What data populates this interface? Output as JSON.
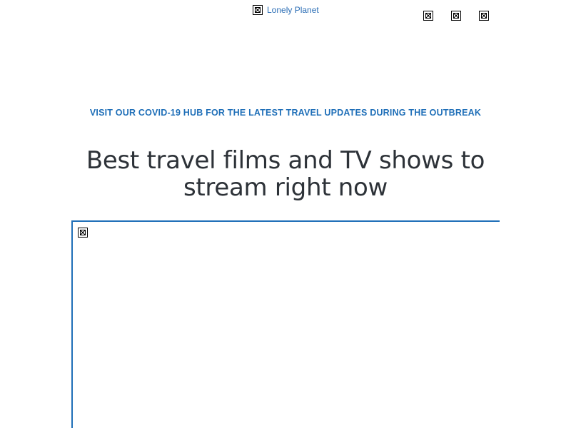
{
  "header": {
    "logo_label": "Lonely Planet",
    "icons": [
      "broken-image-icon",
      "broken-image-icon",
      "broken-image-icon"
    ]
  },
  "banner": {
    "covid_text": "VISIT OUR COVID-19 HUB FOR THE LATEST TRAVEL UPDATES DURING THE OUTBREAK"
  },
  "article": {
    "title": "Best travel films and TV shows to stream right now"
  },
  "colors": {
    "link_blue": "#1f6fb8",
    "title_text": "#2d3238",
    "background": "#ffffff"
  }
}
